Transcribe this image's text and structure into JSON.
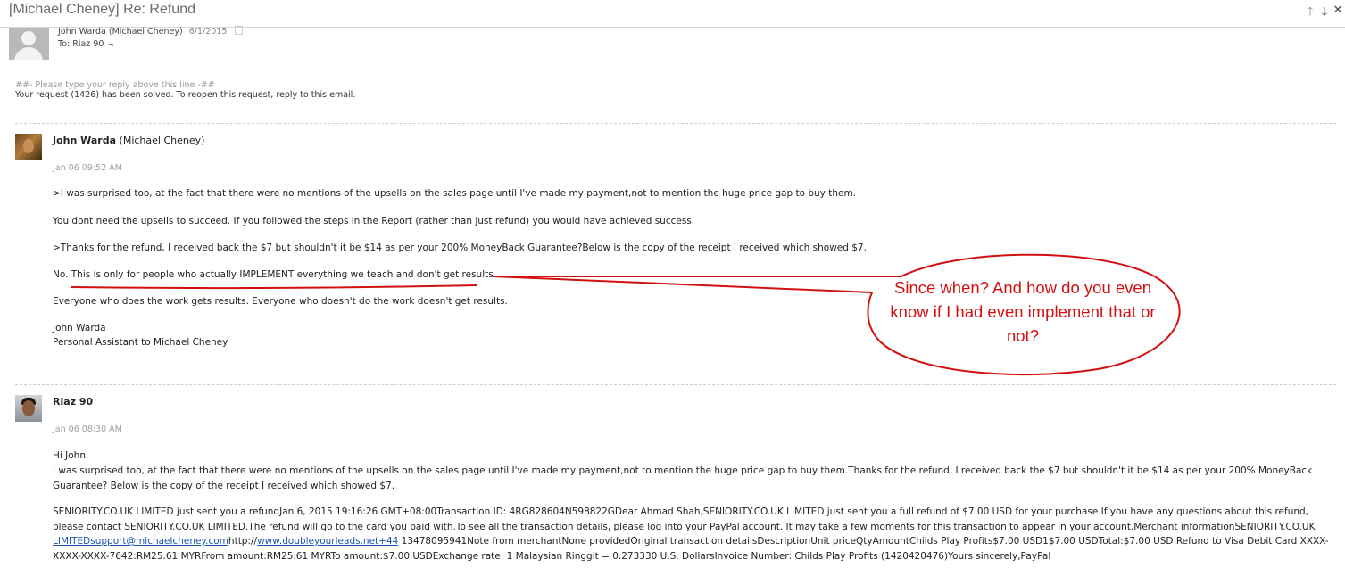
{
  "window": {
    "title": "[Michael Cheney] Re: Refund",
    "controls": {
      "up": "🡑",
      "down": "🡓",
      "close": "✕"
    }
  },
  "header": {
    "from": "John Warda (Michael Cheney)",
    "date": "6/1/2015",
    "to": "To: Riaz 90"
  },
  "notice": {
    "separator": "##- Please type your reply above this line -##",
    "status": "Your request (1426) has been solved. To reopen this request, reply to this email."
  },
  "msg1": {
    "name": "John Warda",
    "org": "(Michael Cheney)",
    "time": "Jan 06 09:52 AM",
    "lines": [
      ">I was surprised too, at the fact that there were no mentions of the upsells on the sales page until I've made my payment,not to mention the huge price gap to buy them.",
      "You dont need the upsells to succeed. If you followed the steps in the Report (rather than just refund) you would have achieved success.",
      ">Thanks for the refund, I received back the $7 but shouldn't it be $14 as per your 200% MoneyBack Guarantee?Below is the copy of the receipt I received which showed $7.",
      "No. This is only for people who actually IMPLEMENT everything we teach and don't get results.",
      "Everyone who does the work gets results. Everyone who doesn't do the work doesn't get results."
    ],
    "sig_name": "John Warda",
    "sig_title": "Personal Assistant to Michael Cheney"
  },
  "callout": {
    "text": "Since when? And how do you even know if I had even implement that or not?",
    "color": "#d21010"
  },
  "msg2": {
    "name": "Riaz 90",
    "time": "Jan 06 08:30 AM",
    "greeting": "Hi John,",
    "body": "I was surprised too, at the fact that there were no mentions of the upsells on the sales page until I've made my payment,not to mention the huge price gap to buy them.Thanks for the refund, I received back the $7 but shouldn't it be $14 as per your 200% MoneyBack Guarantee? Below is the copy of the receipt I received which showed $7.",
    "receipt_a": "SENIORITY.CO.UK LIMITED just sent you a refundJan 6, 2015 19:16:26 GMT+08:00Transaction ID: 4RG828604N598822GDear Ahmad Shah,SENIORITY.CO.UK LIMITED just sent you a full refund of $7.00 USD for your purchase.If you have any questions about this refund, please contact SENIORITY.CO.UK LIMITED.The refund will go to the card you paid with.To see all the transaction details, please log into your PayPal account. It may take a few moments for this transaction to appear in your account.Merchant informationSENIORITY.CO.UK ",
    "receipt_link1": "LIMITEDsupport@michaelcheney.com",
    "receipt_mid": "http://",
    "receipt_link2": "www.doubleyourleads.net+44",
    "receipt_b": " 13478095941Note from merchantNone providedOriginal transaction detailsDescriptionUnit priceQtyAmountChilds Play Profits$7.00 USD1$7.00 USDTotal:$7.00 USD Refund to Visa Debit Card XXXX-XXXX-XXXX-7642:RM25.61 MYRFrom amount:RM25.61 MYRTo amount:$7.00 USDExchange rate: 1 Malaysian Ringgit = 0.273330 U.S. DollarsInvoice Number: Childs Play Profits (1420420476)Yours sincerely,PayPal"
  }
}
